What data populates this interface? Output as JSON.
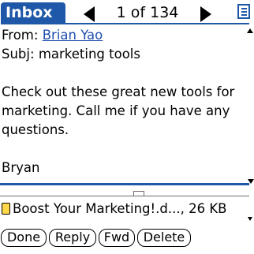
{
  "app": {
    "title": "Inbox",
    "counter": "1 of 134"
  },
  "icons": {
    "prev": "left-triangle-arrow",
    "next": "right-triangle-arrow",
    "menu": "menu-list-icon",
    "attachment": "attachment-note-icon"
  },
  "message": {
    "from_label": "From:",
    "from_name": "Brian Yao",
    "subject_label": "Subj:",
    "subject": "marketing tools",
    "body_lines": [
      "Check out these great new tools for",
      "marketing. Call me if you have any",
      "questions."
    ],
    "signature": "Bryan"
  },
  "attachment": {
    "label": "Boost Your Marketing!.d..., 26 KB"
  },
  "buttons": {
    "done": "Done",
    "reply": "Reply",
    "fwd": "Fwd",
    "delete": "Delete"
  },
  "colors": {
    "accent": "#1f58a8",
    "link": "#1f4fb0",
    "attachment_icon": "#ffd94a"
  }
}
